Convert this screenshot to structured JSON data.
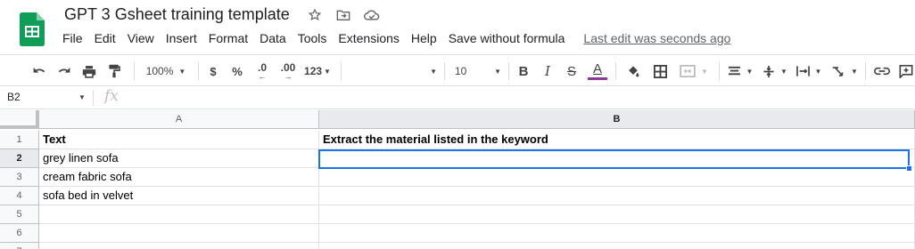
{
  "app": {
    "title": "GPT 3 Gsheet training template"
  },
  "title_icons": [
    "star-icon",
    "move-to-folder-icon",
    "cloud-saved-icon"
  ],
  "menu": {
    "items": [
      "File",
      "Edit",
      "View",
      "Insert",
      "Format",
      "Data",
      "Tools",
      "Extensions",
      "Help",
      "Save without formula"
    ],
    "last_edit": "Last edit was seconds ago"
  },
  "toolbar": {
    "zoom": "100%",
    "currency": "$",
    "percent": "%",
    "decrease_decimal": ".0",
    "increase_decimal": ".00",
    "more_formats": "123",
    "font_size": "10",
    "bold": "B",
    "italic": "I",
    "strikethrough": "S",
    "text_color": "A",
    "text_color_hex": "#8e3a9d"
  },
  "formula_bar": {
    "name_box": "B2",
    "fx": "fx",
    "value": ""
  },
  "sheet": {
    "columns": [
      "A",
      "B"
    ],
    "selected_cell": "B2",
    "rows": [
      {
        "num": "1",
        "A": "Text",
        "B": "Extract the material listed in the keyword"
      },
      {
        "num": "2",
        "A": "grey linen sofa",
        "B": ""
      },
      {
        "num": "3",
        "A": "cream fabric sofa",
        "B": ""
      },
      {
        "num": "4",
        "A": "sofa bed in velvet",
        "B": ""
      },
      {
        "num": "5",
        "A": "",
        "B": ""
      },
      {
        "num": "6",
        "A": "",
        "B": ""
      },
      {
        "num": "7",
        "A": "",
        "B": ""
      }
    ]
  },
  "colors": {
    "brand_green": "#0f9d58",
    "selection_blue": "#1a73e8",
    "header_bg": "#f8f9fa"
  }
}
